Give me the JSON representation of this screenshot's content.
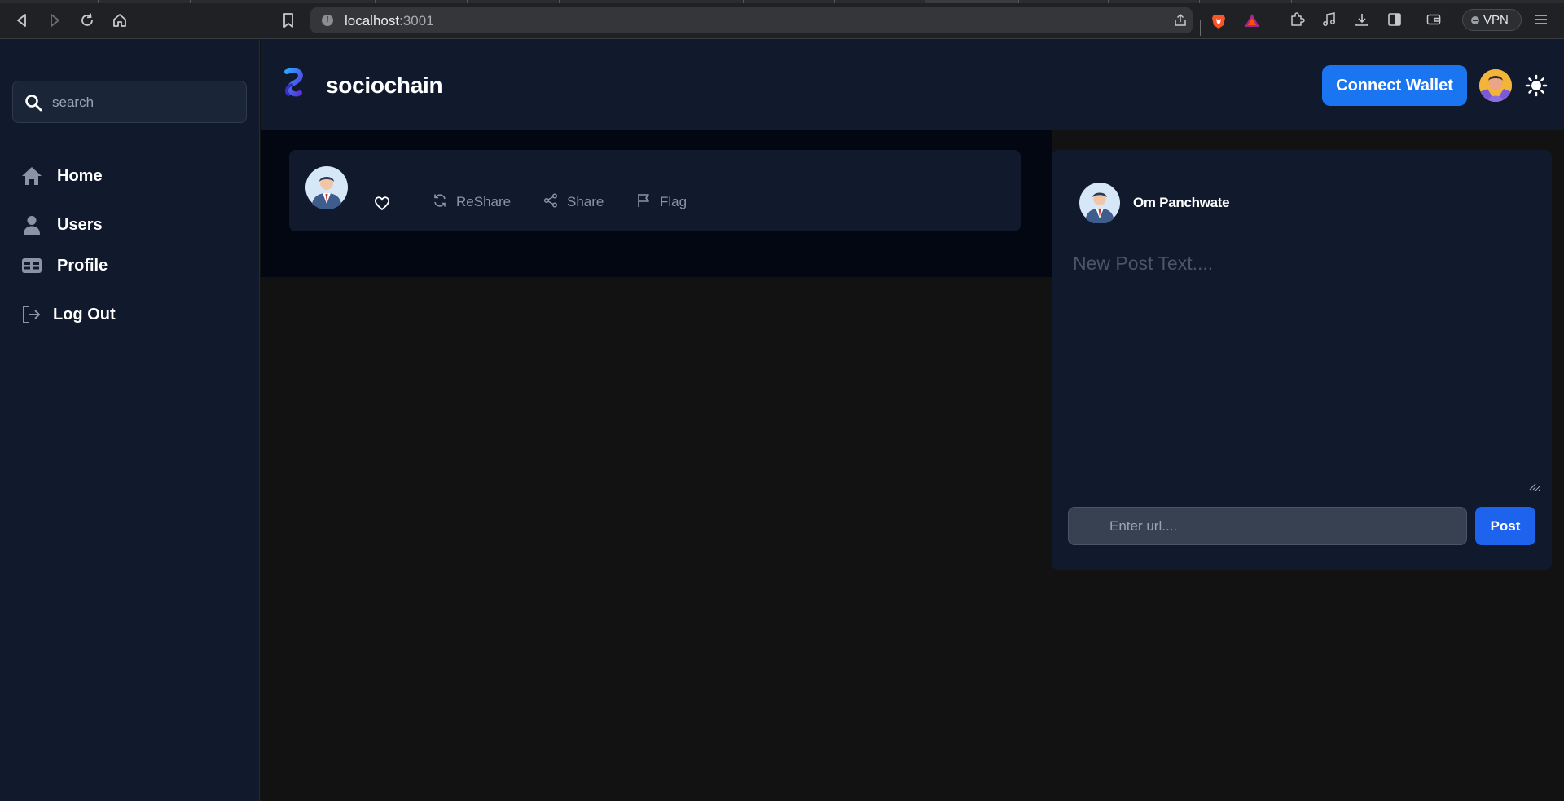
{
  "browser": {
    "url_host": "localhost",
    "url_port": ":3001",
    "vpn_label": "VPN"
  },
  "sidebar": {
    "search_placeholder": "search",
    "items": [
      {
        "label": "Home",
        "icon": "home-icon"
      },
      {
        "label": "Users",
        "icon": "user-icon"
      },
      {
        "label": "Profile",
        "icon": "profile-card-icon"
      },
      {
        "label": "Log Out",
        "icon": "logout-icon"
      }
    ]
  },
  "header": {
    "brand": "sociochain",
    "connect_label": "Connect Wallet"
  },
  "post": {
    "actions": [
      {
        "label": "ReShare",
        "icon": "reshare-icon"
      },
      {
        "label": "Share",
        "icon": "share-icon"
      },
      {
        "label": "Flag",
        "icon": "flag-icon"
      }
    ]
  },
  "composer": {
    "user_name": "Om Panchwate",
    "text_placeholder": "New Post Text....",
    "url_placeholder": "Enter url....",
    "post_label": "Post"
  },
  "colors": {
    "accent": "#1b74f0",
    "post_button": "#1d63ed",
    "panel": "#111a2d",
    "background": "#121212"
  }
}
